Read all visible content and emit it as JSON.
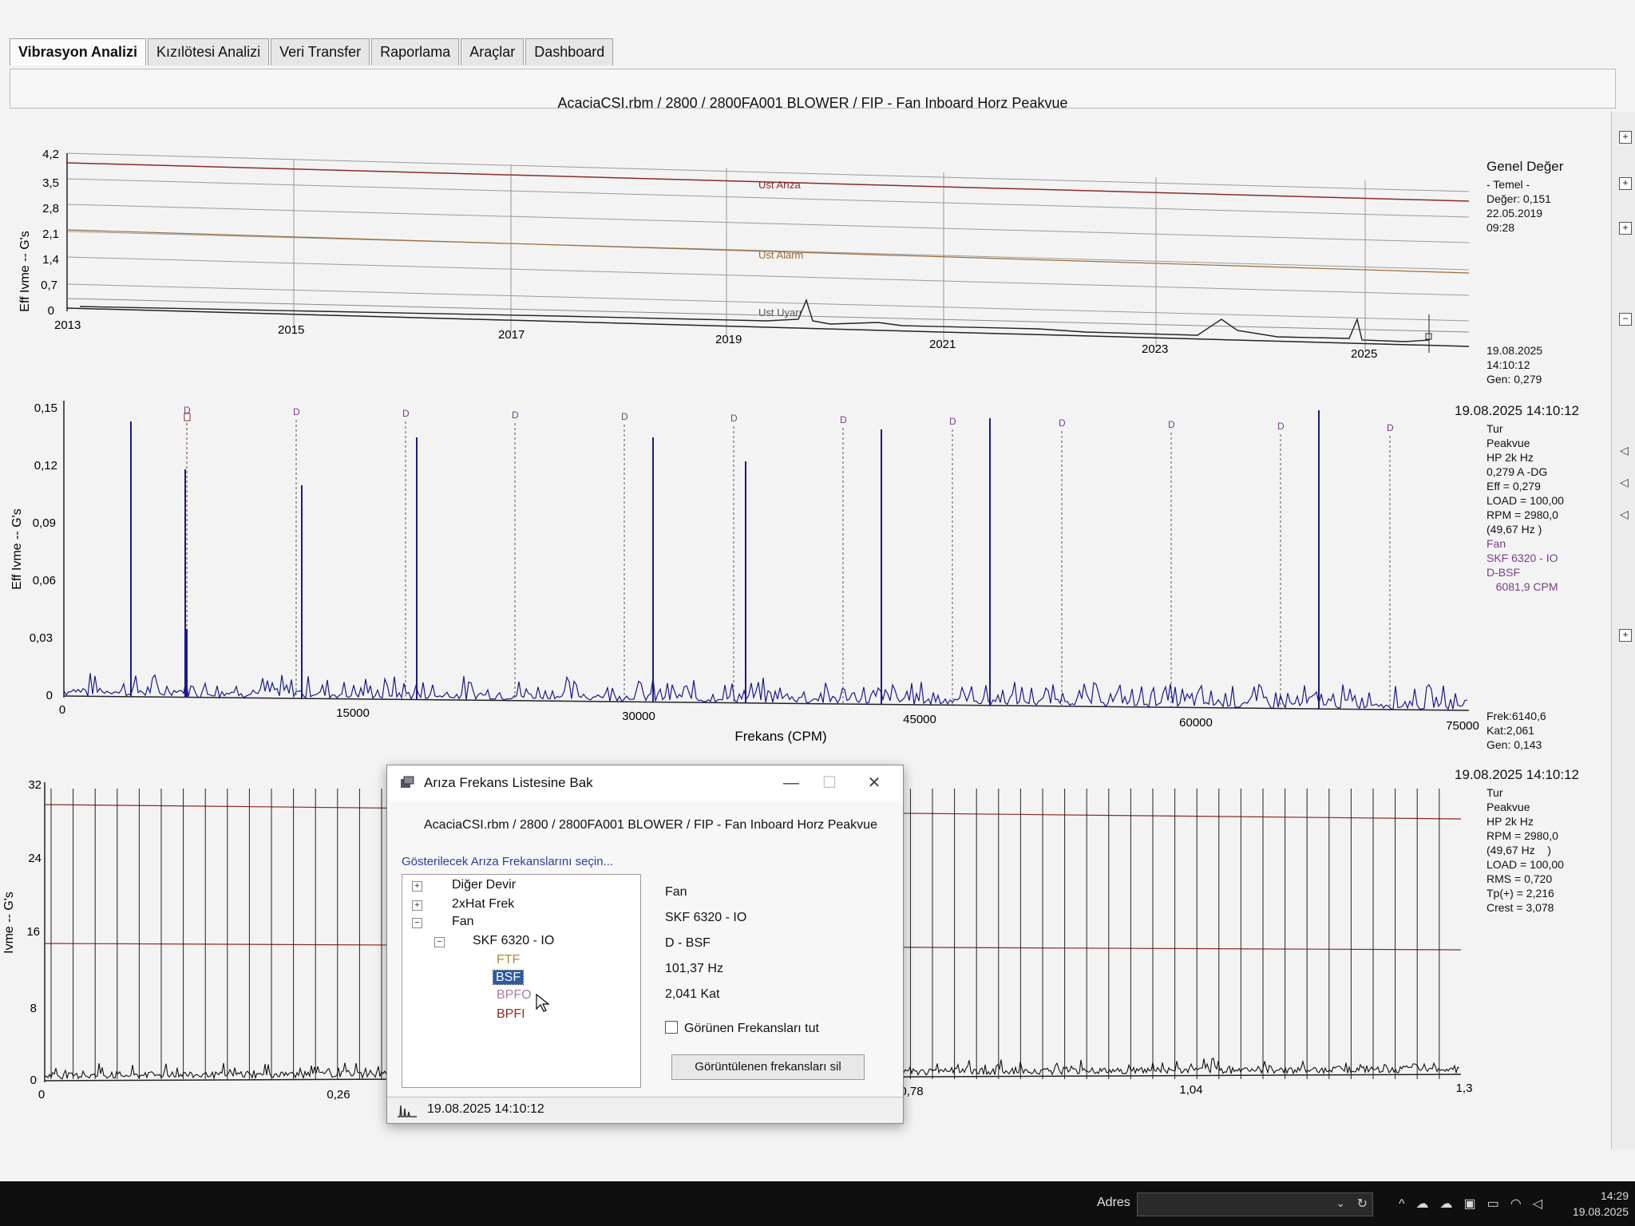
{
  "tabs": [
    "Vibrasyon Analizi",
    "Kızılötesi Analizi",
    "Veri Transfer",
    "Raporlama",
    "Araçlar",
    "Dashboard"
  ],
  "plot_title": "AcaciaCSI.rbm / 2800 / 2800FA001 BLOWER / FIP - Fan Inboard Horz Peakvue",
  "trend": {
    "ylabel": "Eff Ivme -- G's",
    "yticks": [
      "0",
      "0,7",
      "1,4",
      "2,1",
      "2,8",
      "3,5",
      "4,2"
    ],
    "xticks": [
      "2013",
      "2015",
      "2017",
      "2019",
      "2021",
      "2023",
      "2025"
    ],
    "limits": [
      "Ust Arıza",
      "Ust Alarm",
      "Ust Uyarı"
    ],
    "side_title": "Genel Değer",
    "side_lines": [
      "- Temel -",
      "Değer: 0,151",
      "22.05.2019",
      "09:28"
    ],
    "side_bottom": [
      "19.08.2025",
      "14:10:12",
      "Gen: 0,279"
    ]
  },
  "spectrum": {
    "ylabel": "Eff Ivme -- G's",
    "yticks": [
      "0",
      "0,03",
      "0,06",
      "0,09",
      "0,12",
      "0,15"
    ],
    "xticks": [
      "0",
      "15000",
      "30000",
      "45000",
      "60000",
      "75000"
    ],
    "xlabel": "Frekans (CPM)",
    "marker_label": "D",
    "date": "19.08.2025 14:10:12",
    "info": [
      "Tur",
      "Peakvue",
      "HP 2k Hz",
      "0,279 A -DG",
      "Eff = 0,279",
      "LOAD = 100,00",
      "RPM = 2980,0",
      "(49,67 Hz    )"
    ],
    "info_purple": [
      "Fan",
      "SKF 6320 - IO",
      "D-BSF",
      "   6081,9 CPM"
    ],
    "cursor": [
      "Frek:6140,6",
      "Kat:2,061",
      "Gen: 0,143"
    ]
  },
  "waveform": {
    "ylabel": "Ivme -- G's",
    "yticks": [
      "0",
      "8",
      "16",
      "24",
      "32"
    ],
    "xticks": [
      "0",
      "0,26",
      "0,78",
      "1,04",
      "1,3"
    ],
    "date": "19.08.2025 14:10:12",
    "info": [
      "Tur",
      "Peakvue",
      "HP 2k Hz",
      "RPM = 2980,0",
      "(49,67 Hz    )",
      "LOAD = 100,00",
      "RMS = 0,720",
      "Tp(+) = 2,216",
      "Crest = 3,078"
    ]
  },
  "dialog": {
    "title": "Arıza Frekans Listesine Bak",
    "path": "AcaciaCSI.rbm / 2800 / 2800FA001 BLOWER / FIP - Fan Inboard Horz Peakvue",
    "prompt": "Gösterilecek Arıza Frekanslarını seçin...",
    "tree": {
      "diger_devir": "Diğer Devir",
      "hat_frek": "2xHat Frek",
      "fan": "Fan",
      "bearing": "SKF 6320 - IO",
      "ftf": "FTF",
      "bsf": "BSF",
      "bpfo": "BPFO",
      "bpfi": "BPFI"
    },
    "info": [
      "Fan",
      "SKF 6320 - IO",
      "D - BSF",
      "101,37 Hz",
      "2,041 Kat"
    ],
    "keep_label": "Görünen Frekansları tut",
    "clear_button": "Görüntülenen frekansları sil",
    "status": "19.08.2025 14:10:12"
  },
  "taskbar": {
    "address_label": "Adres",
    "time": "14:29",
    "date": "19.08.2025"
  }
}
